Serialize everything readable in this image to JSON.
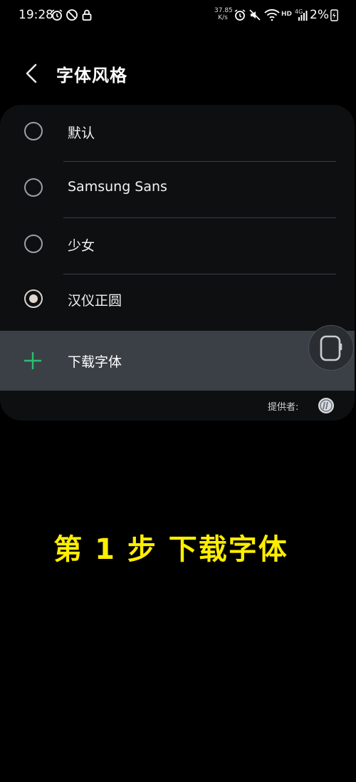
{
  "status_bar": {
    "time": "19:28",
    "net_speed_value": "37.85",
    "net_speed_unit": "K/s",
    "hd": "HD",
    "network": "4G",
    "battery": "2%",
    "icons": [
      "alarm-icon",
      "no-disturb-icon",
      "lock-icon",
      "alarm-icon",
      "mute-icon",
      "wifi-icon",
      "signal-icon",
      "battery-charging-icon"
    ]
  },
  "header": {
    "title": "字体风格",
    "back_icon": "chevron-left-icon"
  },
  "font_options": [
    {
      "label": "默认",
      "selected": false
    },
    {
      "label": "Samsung Sans",
      "selected": false
    },
    {
      "label": "少女",
      "selected": false
    },
    {
      "label": "汉仪正圆",
      "selected": true
    }
  ],
  "download": {
    "label": "下载字体",
    "icon": "plus-icon",
    "accent_color": "#2dbd6e"
  },
  "provider": {
    "label": "提供者:"
  },
  "caption": {
    "text": "第 1 步  下载字体",
    "color": "#ffee00"
  }
}
